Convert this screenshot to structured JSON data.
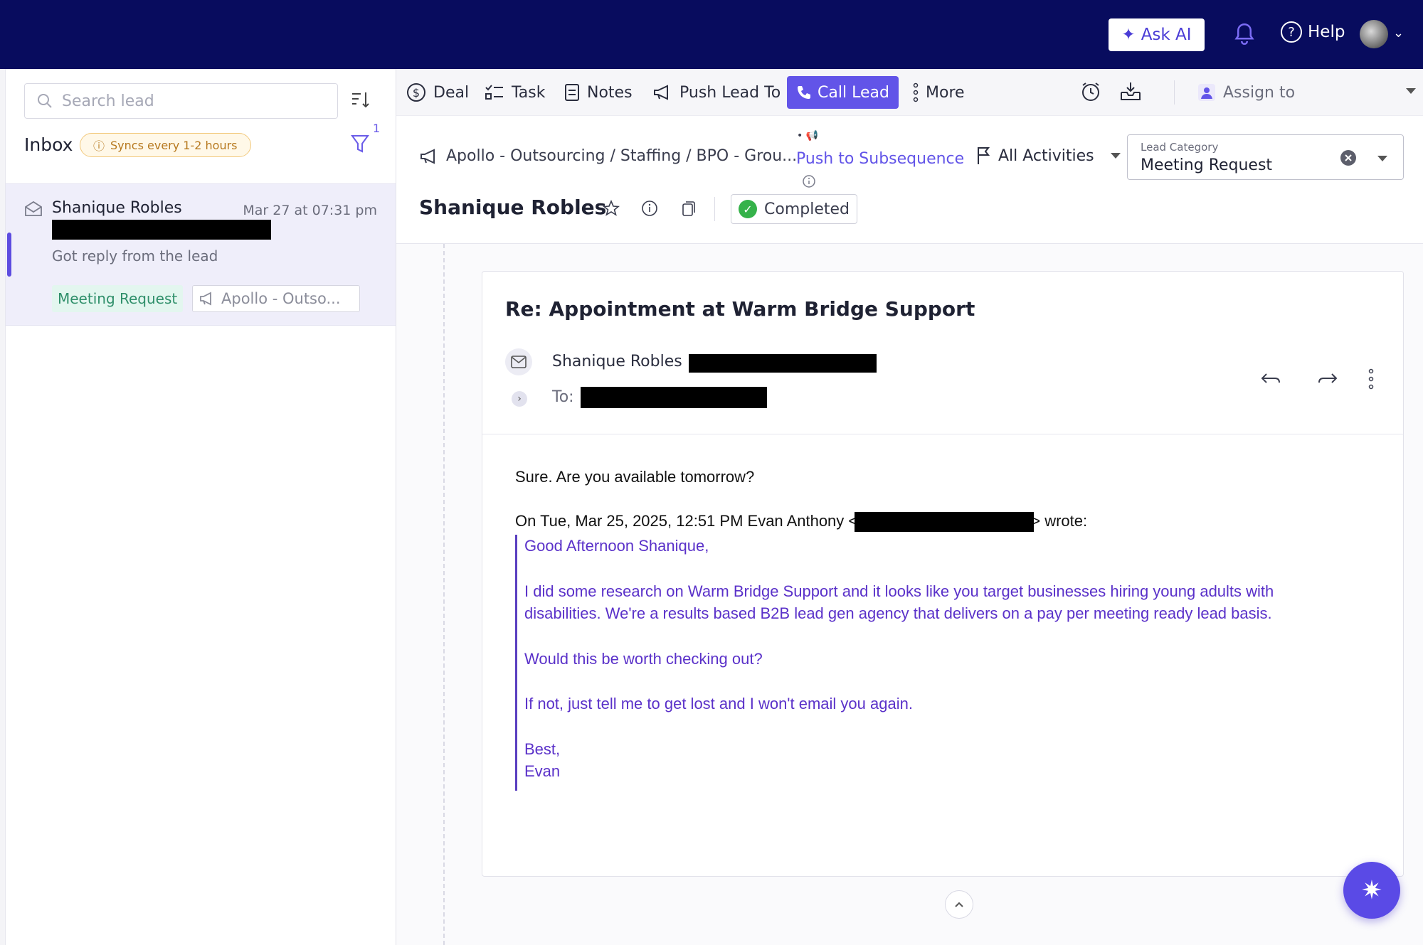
{
  "topbar": {
    "ask_ai_label": "Ask AI",
    "help_label": "Help"
  },
  "sidebar": {
    "search_placeholder": "Search lead",
    "inbox_title": "Inbox",
    "sync_badge": "Syncs every 1-2 hours",
    "filter_count": "1",
    "lead": {
      "name": "Shanique Robles",
      "date": "Mar 27 at 07:31 pm",
      "snippet": "Got reply from the lead",
      "tag_category": "Meeting Request",
      "tag_campaign": "Apollo - Outso..."
    }
  },
  "toolbar": {
    "deal": "Deal",
    "task": "Task",
    "notes": "Notes",
    "push_lead": "Push Lead To",
    "call_lead": "Call Lead",
    "more": "More",
    "assign_to": "Assign to"
  },
  "lead_header": {
    "campaign_path": "Apollo - Outsourcing / Staffing / BPO - Grou...",
    "push_to_subsequence": "Push to Subsequence",
    "all_activities": "All Activities",
    "lead_category_label": "Lead Category",
    "lead_category_value": "Meeting Request",
    "contact_name": "Shanique Robles",
    "status": "Completed"
  },
  "email": {
    "subject": "Re: Appointment at Warm Bridge Support",
    "from_name": "Shanique Robles",
    "to_label": "To:",
    "body": "Sure. Are you available tomorrow?",
    "reply_prefix": "On Tue, Mar 25, 2025, 12:51 PM Evan Anthony <",
    "reply_suffix": "> wrote:",
    "quote": {
      "greeting": "Good Afternoon Shanique,",
      "para1": "I did some research on Warm Bridge Support and it looks like you target businesses hiring young adults with disabilities. We're a results based B2B lead gen agency that delivers on a pay per meeting ready lead basis.",
      "para2": "Would this be worth checking out?",
      "para3": "If not, just tell me to get lost and I won't email you again.",
      "signoff1": "Best,",
      "signoff2": "Evan"
    }
  },
  "colors": {
    "topbar": "#080c5e",
    "accent": "#6254e8",
    "quote_text": "#5a31c9",
    "success": "#35b24a"
  }
}
